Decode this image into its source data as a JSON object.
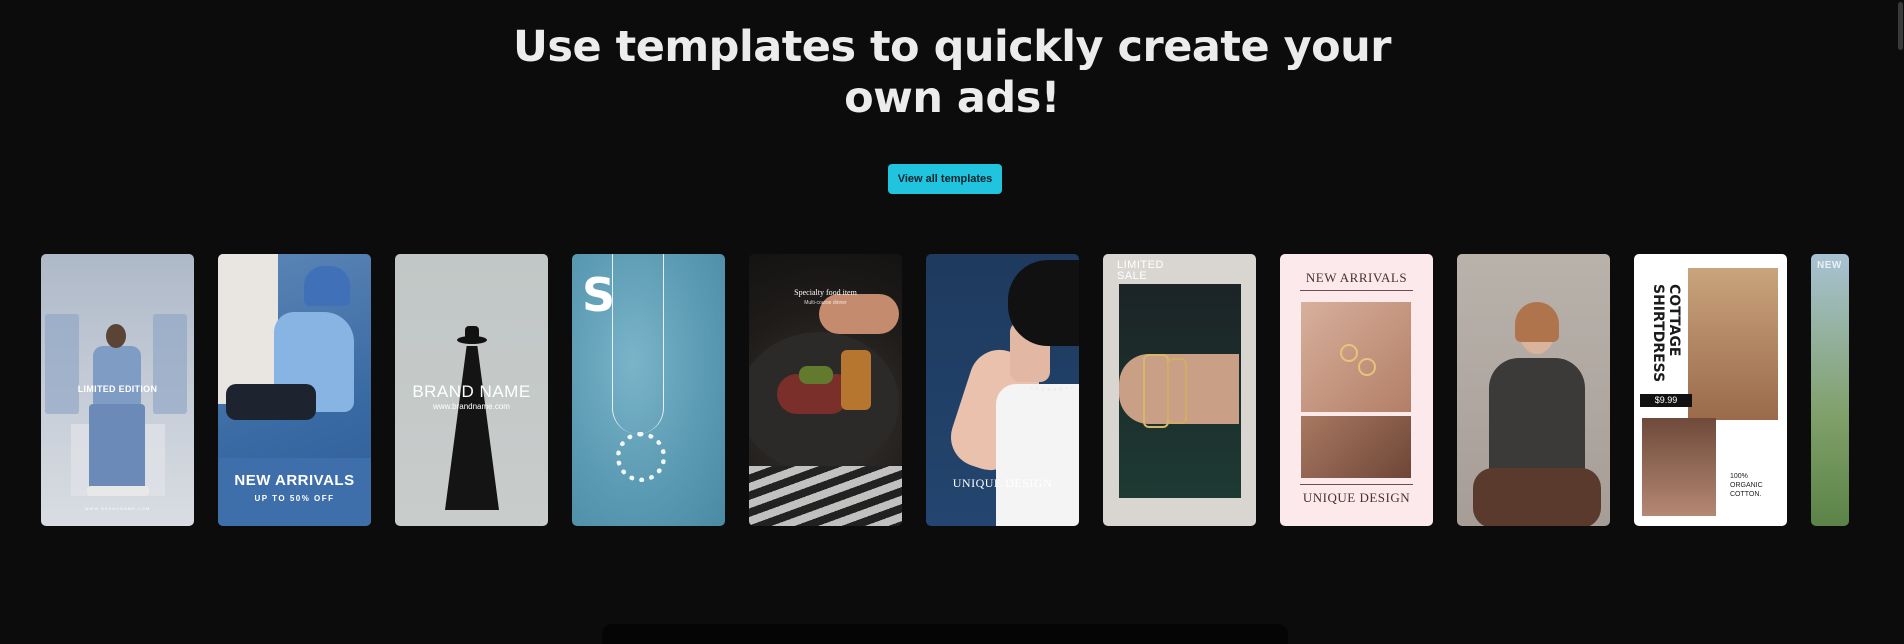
{
  "headline": {
    "line1": "Use templates to quickly create your",
    "line2": "own ads!"
  },
  "cta": {
    "label": "View all templates"
  },
  "templates": [
    {
      "name": "Limited Edition",
      "text": "LIMITED EDITION",
      "subtext": "WWW.BRANDNAME.COM"
    },
    {
      "name": "New Arrivals Blue",
      "text": "NEW ARRIVALS",
      "subtext": "UP TO 50% OFF"
    },
    {
      "name": "Brand Name",
      "text": "BRAND NAME",
      "subtext": "www.brandname.com"
    },
    {
      "name": "Necklace",
      "text": "S"
    },
    {
      "name": "Specialty Food",
      "text": "Specialty food item",
      "subtext": "Multi-course dinner"
    },
    {
      "name": "Unique Design Pearls",
      "text": "UNIQUE DESIGN"
    },
    {
      "name": "Limited Sale",
      "text": "LIMITED SALE"
    },
    {
      "name": "New Arrivals Rings",
      "text": "NEW ARRIVALS",
      "subtext": "UNIQUE DESIGN"
    },
    {
      "name": "Portrait"
    },
    {
      "name": "Cottage Shirtdress",
      "text": "COTTAGE SHIRTDRESS",
      "price": "$9.99",
      "note": "100% ORGANIC COTTON."
    },
    {
      "name": "New Partial",
      "text": "NEW"
    }
  ]
}
